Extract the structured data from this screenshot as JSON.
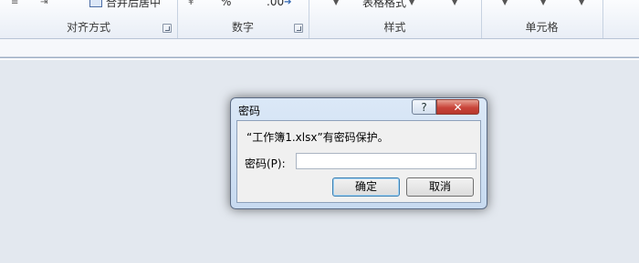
{
  "ribbon": {
    "groups": {
      "alignment": {
        "label": "对齐方式"
      },
      "number": {
        "label": "数字"
      },
      "styles": {
        "label": "样式",
        "table_format": "表格格式"
      },
      "cells": {
        "label": "单元格"
      }
    },
    "top_fragments": {
      "merge_center": "合并后居中",
      "percent": "%",
      "decimal": ".00"
    }
  },
  "dialog": {
    "title": "密码",
    "help_glyph": "?",
    "close_glyph": "✕",
    "message": "“工作簿1.xlsx”有密码保护。",
    "password_label": "密码(P):",
    "password_value": "",
    "ok_label": "确定",
    "cancel_label": "取消"
  }
}
